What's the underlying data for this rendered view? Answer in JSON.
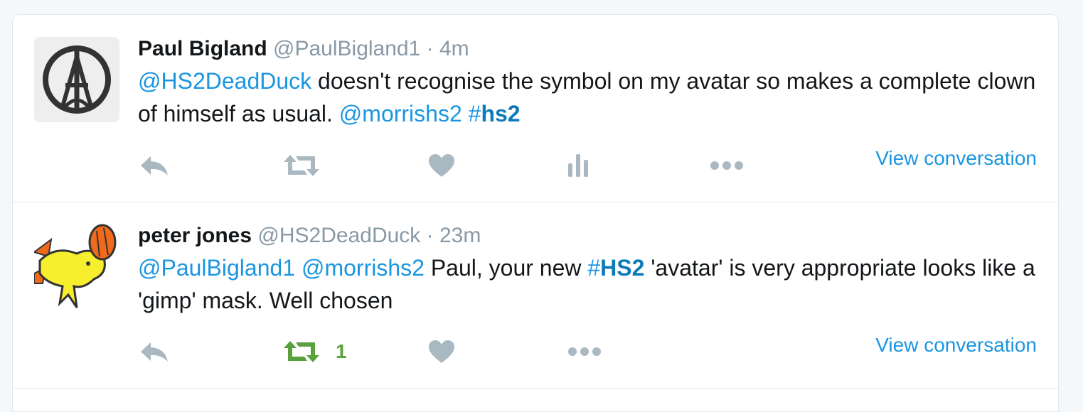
{
  "colors": {
    "link": "#1b95e0",
    "muted": "#8899a6",
    "retweeted": "#5aa03c",
    "border": "#e1e8ed"
  },
  "tweets": [
    {
      "fullname": "Paul Bigland",
      "username": "@PaulBigland1",
      "separator": "·",
      "time": "4m",
      "avatar_icon": "peace-eiffel-icon",
      "text": [
        {
          "type": "mention",
          "text": "@HS2DeadDuck"
        },
        {
          "type": "text",
          "text": " doesn't recognise the symbol on my avatar so makes a complete clown of himself as usual. "
        },
        {
          "type": "mention",
          "text": "@morrishs2"
        },
        {
          "type": "text",
          "text": " "
        },
        {
          "type": "hash",
          "text": "#"
        },
        {
          "type": "hashtag",
          "text": "hs2"
        }
      ],
      "actions": [
        "reply-icon",
        "retweet-icon",
        "like-icon",
        "analytics-icon",
        "more-icon"
      ],
      "view_conversation": "View conversation"
    },
    {
      "fullname": "peter jones",
      "username": "@HS2DeadDuck",
      "separator": "·",
      "time": "23m",
      "avatar_icon": "duck-icon",
      "text": [
        {
          "type": "mention",
          "text": "@PaulBigland1"
        },
        {
          "type": "text",
          "text": " "
        },
        {
          "type": "mention",
          "text": "@morrishs2"
        },
        {
          "type": "text",
          "text": " Paul, your new "
        },
        {
          "type": "hash",
          "text": "#"
        },
        {
          "type": "hashtag",
          "text": "HS2"
        },
        {
          "type": "text",
          "text": " 'avatar' is very appropriate looks like a 'gimp' mask. Well chosen"
        }
      ],
      "actions": [
        "reply-icon",
        "retweet-icon",
        "like-icon",
        "more-icon"
      ],
      "retweet_count": "1",
      "view_conversation": "View conversation"
    }
  ]
}
